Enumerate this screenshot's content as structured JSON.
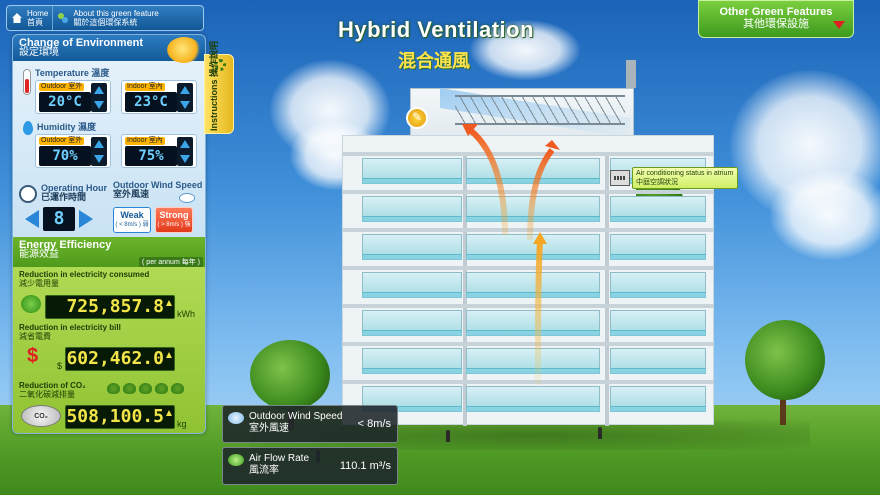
{
  "nav": {
    "home_en": "Home",
    "home_zh": "首頁",
    "about_en": "About this green feature",
    "about_zh": "關於這個環保系統"
  },
  "title": {
    "en": "Hybrid Ventilation",
    "zh": "混合通風"
  },
  "other_features": {
    "en": "Other Green Features",
    "zh": "其他環保設施"
  },
  "environment": {
    "heading_en": "Change of Environment",
    "heading_zh": "設定環境",
    "temperature": {
      "label_en": "Temperature",
      "label_zh": "溫度",
      "outdoor_caption": "Outdoor 室外",
      "outdoor_value": "20°C",
      "indoor_caption": "Indoor 室內",
      "indoor_value": "23°C"
    },
    "humidity": {
      "label_en": "Humidity",
      "label_zh": "濕度",
      "outdoor_caption": "Outdoor 室外",
      "outdoor_value": "70%",
      "indoor_caption": "Indoor 室內",
      "indoor_value": "75%"
    },
    "operating_hour": {
      "label_en": "Operating Hour",
      "label_zh": "已運作時間",
      "value": "8"
    },
    "wind_speed": {
      "label_en": "Outdoor Wind Speed",
      "label_zh": "室外風速",
      "weak_label": "Weak",
      "weak_sub": "( < 8m/s ) 弱",
      "strong_label": "Strong",
      "strong_sub": "( > 8m/s ) 強"
    }
  },
  "instructions": {
    "en": "Instructions",
    "zh": "操作說明"
  },
  "energy": {
    "heading_en": "Energy Efficiency",
    "heading_zh": "能源效益",
    "per_annum": "( per annum 每年 )",
    "electricity_consumed": {
      "label_en": "Reduction in electricity consumed",
      "label_zh": "減少電用量",
      "value": "725,857.8",
      "unit": "kWh"
    },
    "electricity_bill": {
      "label_en": "Reduction in electricity bill",
      "label_zh": "減省電費",
      "value": "602,462.0",
      "unit": "$"
    },
    "co2": {
      "label_en": "Reduction of CO₂",
      "label_zh": "二氧化碳減排量",
      "value": "508,100.5",
      "unit": "kg"
    }
  },
  "building": {
    "ac_status_en": "Air conditioning status in atrium",
    "ac_status_zh": "中庭空調狀況"
  },
  "readouts": {
    "wind_speed_label_en": "Outdoor Wind Speed",
    "wind_speed_label_zh": "室外風速",
    "wind_speed_value": "< 8m/s",
    "airflow_label_en": "Air Flow Rate",
    "airflow_label_zh": "風流率",
    "airflow_value": "110.1 m³/s"
  },
  "colors": {
    "sky_top": "#1b63b8",
    "panel_blue": "#145a98",
    "panel_green": "#8fc232",
    "lcd_blue_text": "#6fd0ff",
    "lcd_yellow_text": "#f2e54a",
    "warm_air_arrow": "#f05a20",
    "rising_air_arrow": "#f5a623",
    "cool_air": "#8ec8f0"
  },
  "icons": [
    "home-icon",
    "info-icon",
    "sun-icon",
    "thermometer-icon",
    "droplet-icon",
    "clock-icon",
    "cloud-wind-icon",
    "plug-icon",
    "dollar-icon",
    "co2-icon",
    "wrench-icon",
    "aircon-icon",
    "dropdown-arrow-icon"
  ]
}
